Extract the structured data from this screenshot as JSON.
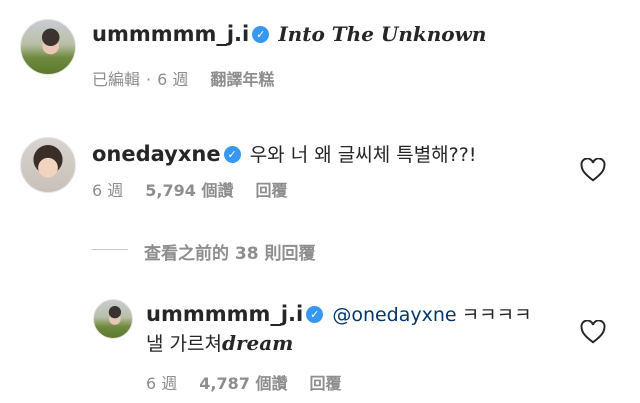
{
  "comment1": {
    "username": "ummmmm_j.i",
    "text": "Into The Unknown",
    "meta_edited": "已編輯",
    "meta_time": "6 週",
    "meta_translate": "翻譯年糕"
  },
  "comment2": {
    "username": "onedayxne",
    "text": "우와 너 왜 글씨체 특별해??!",
    "meta_time": "6 週",
    "meta_likes": "5,794 個讚",
    "meta_reply": "回覆"
  },
  "view_previous": "查看之前的 38 則回覆",
  "reply1": {
    "username": "ummmmm_j.i",
    "mention": "@onedayxne",
    "text_line1_tail": "ㅋㅋㅋㅋ",
    "text_line2_ko": "낼 가르쳐",
    "text_line2_styled": "dream",
    "meta_time": "6 週",
    "meta_likes": "4,787 個讚",
    "meta_reply": "回覆"
  },
  "icons": [
    "verified-badge-icon",
    "heart-icon"
  ],
  "colors": {
    "verified": "#3897f0",
    "meta": "#8e8e8e",
    "mention": "#00376b"
  }
}
